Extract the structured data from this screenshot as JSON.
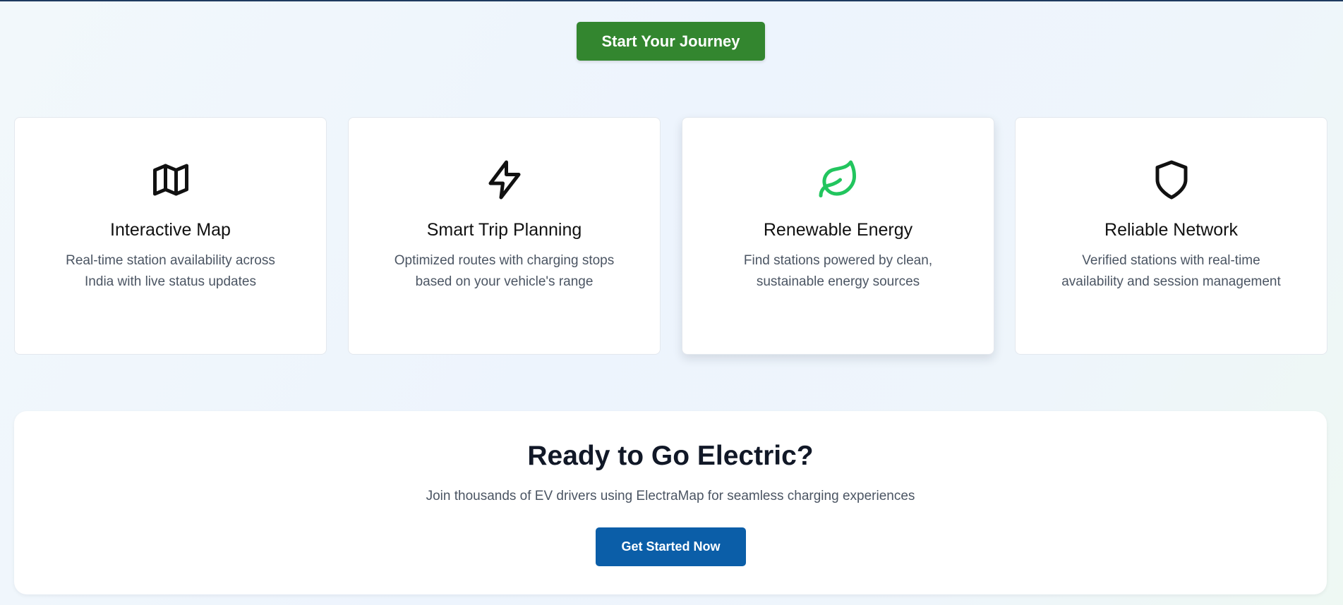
{
  "hero": {
    "button_label": "Start Your Journey",
    "button_color": "#33862f"
  },
  "features": [
    {
      "icon": "map-icon",
      "title": "Interactive Map",
      "description": "Real-time station availability across India with live status updates"
    },
    {
      "icon": "lightning-bolt-icon",
      "title": "Smart Trip Planning",
      "description": "Optimized routes with charging stops based on your vehicle's range"
    },
    {
      "icon": "leaf-icon",
      "icon_color": "#22c55e",
      "title": "Renewable Energy",
      "description": "Find stations powered by clean, sustainable energy sources"
    },
    {
      "icon": "shield-icon",
      "title": "Reliable Network",
      "description": "Verified stations with real-time availability and session management"
    }
  ],
  "cta": {
    "heading": "Ready to Go Electric?",
    "subtext": "Join thousands of EV drivers using ElectraMap for seamless charging experiences",
    "button_label": "Get Started Now",
    "button_color": "#0b5ea8"
  }
}
